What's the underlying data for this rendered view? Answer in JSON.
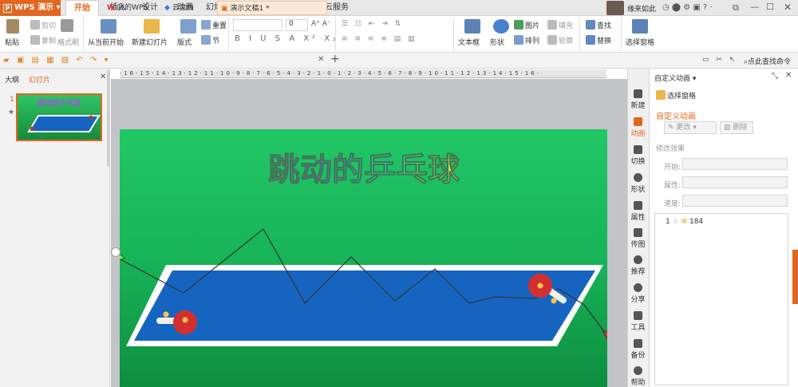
{
  "app": {
    "title": "WPS 演示"
  },
  "menu": {
    "tabs": [
      "开始",
      "插入",
      "设计",
      "动画",
      "幻灯片放映",
      "审阅",
      "视图",
      "云服务"
    ],
    "active": 0,
    "user": "缘来如此"
  },
  "ribbon": {
    "paste": "粘贴",
    "cut": "剪切",
    "copy": "复制",
    "format_painter": "格式刷",
    "from_current": "从当前开始",
    "new_slide": "新建幻灯片",
    "layout": "版式",
    "reset": "重置",
    "section": "节",
    "font_size": "0",
    "text_box": "文本框",
    "shapes": "形状",
    "picture": "图片",
    "fill": "填充",
    "arrange": "排列",
    "outline": "轮廓",
    "find": "查找",
    "replace": "替换",
    "selection_pane": "选择窗格"
  },
  "docs": {
    "tabs": [
      "我的WPS",
      "云文档",
      "演示文稿1 *"
    ],
    "search": "点此查找命令"
  },
  "panel": {
    "outline": "大纲",
    "slides": "幻灯片",
    "slide_number": "1"
  },
  "slide": {
    "title": "跳动的乒乓球",
    "thumb_title": "跳动的乒乓球"
  },
  "ruler": {
    "label": "·16·15·14·13·12·11·10·9·8·7·6·5·4·3·2·1·0·1·2·3·4·5·6·7·8·9·10·11·12·13·14·15·16·"
  },
  "sidebar": {
    "items": [
      "新建",
      "动画",
      "切换",
      "形状",
      "属性",
      "传图",
      "推荐",
      "分享",
      "工具",
      "备份",
      "帮助"
    ]
  },
  "taskpane": {
    "title": "自定义动画",
    "select_pane": "选择窗格",
    "section": "自定义动画",
    "change": "更改",
    "delete": "删除",
    "modify": "修改效果",
    "start": "开始:",
    "property": "属性:",
    "speed": "速度:",
    "item_index": "1",
    "item_name": "184"
  },
  "colors": {
    "accent": "#e2661f",
    "table": "#1565c0",
    "slide_top": "#22c766",
    "slide_bottom": "#0d8e3f"
  }
}
